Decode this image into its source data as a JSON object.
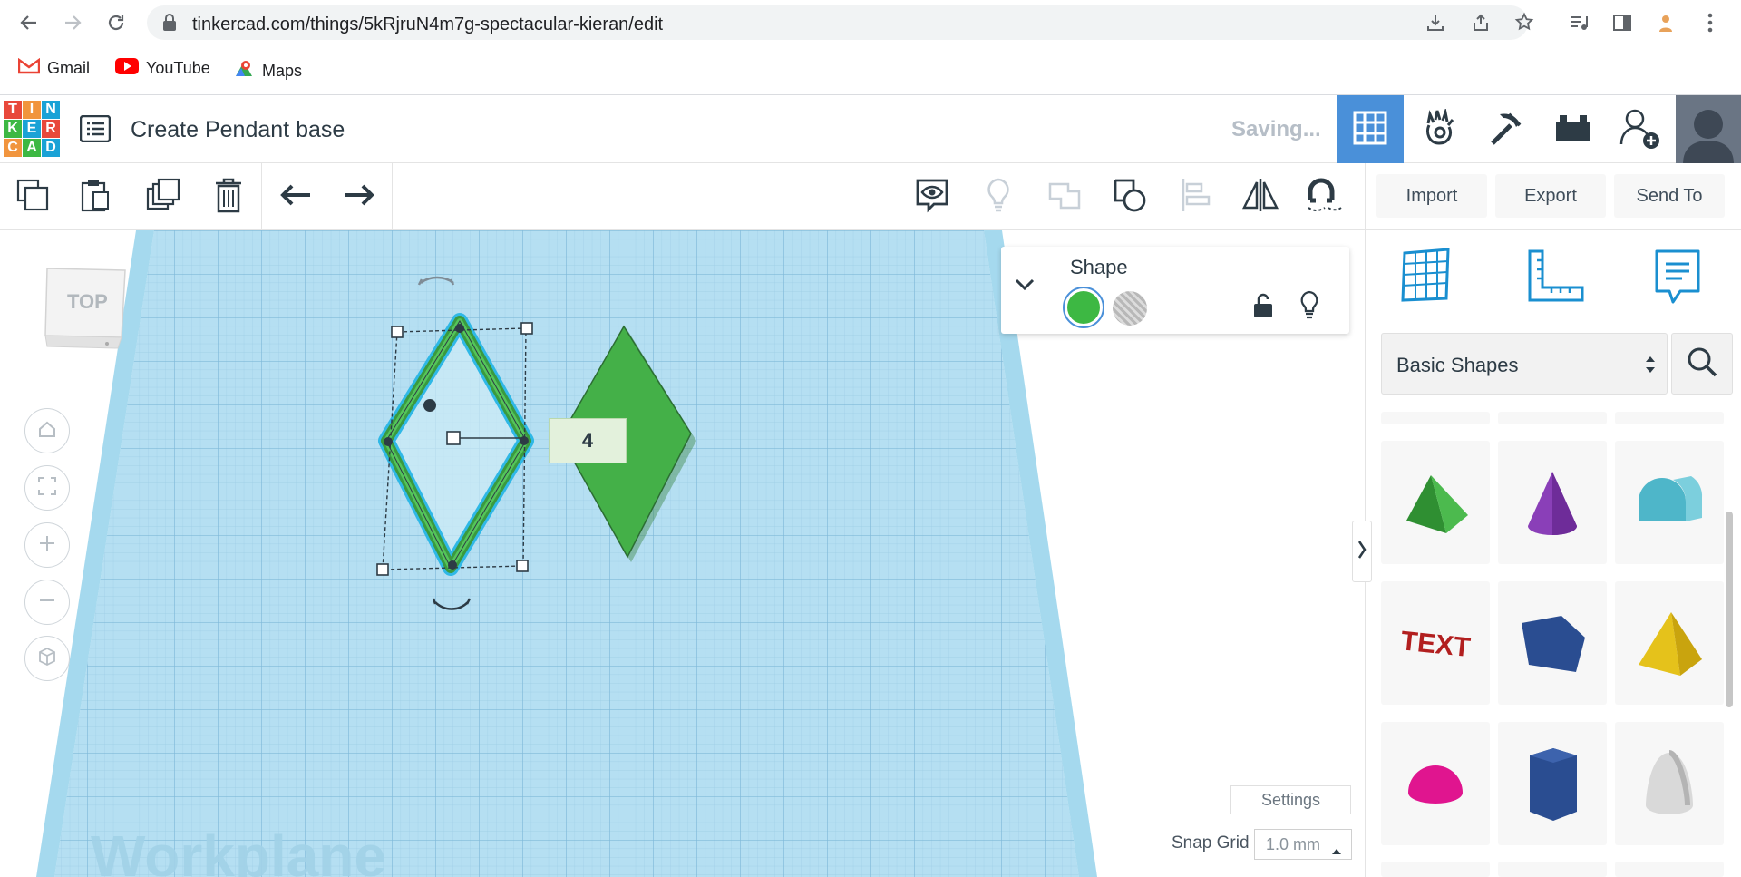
{
  "browser": {
    "url": "tinkercad.com/things/5kRjruN4m7g-spectacular-kieran/edit",
    "bookmarks": [
      {
        "label": "Gmail",
        "icon": "gmail-icon"
      },
      {
        "label": "YouTube",
        "icon": "youtube-icon"
      },
      {
        "label": "Maps",
        "icon": "maps-icon"
      }
    ]
  },
  "header": {
    "logo_letters": [
      "T",
      "I",
      "N",
      "K",
      "E",
      "R",
      "C",
      "A",
      "D"
    ],
    "title": "Create Pendant base",
    "status": "Saving..."
  },
  "toolbar": {
    "import_label": "Import",
    "export_label": "Export",
    "send_to_label": "Send To"
  },
  "workplane": {
    "view_cube_label": "TOP",
    "dimension_value": "4",
    "watermark": "Workplane"
  },
  "inspector": {
    "title": "Shape",
    "solid_color": "#3db843"
  },
  "library": {
    "category": "Basic Shapes",
    "shapes": [
      "Roof",
      "Cone",
      "Half Cylinder",
      "Text",
      "Polygon",
      "Pyramid",
      "Half Sphere",
      "Hexagonal Prism",
      "Paraboloid"
    ]
  },
  "footer": {
    "settings_label": "Settings",
    "snap_label": "Snap Grid",
    "snap_value": "1.0 mm"
  },
  "colors": {
    "accent": "#4a90d9",
    "shape_green": "#3db843",
    "workplane_blue": "#a8d8ee",
    "selection_blue": "#2fb8e6"
  }
}
